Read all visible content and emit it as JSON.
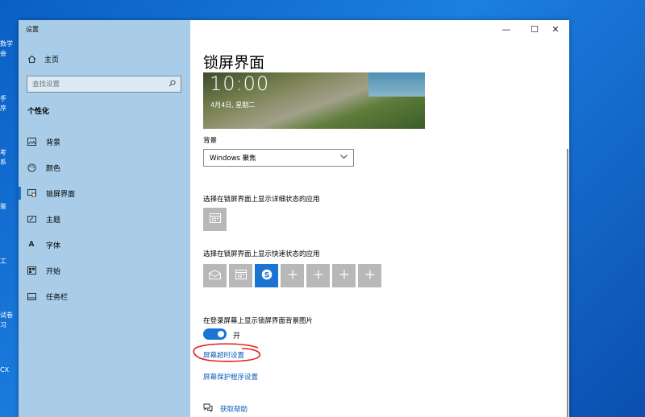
{
  "desktop": {
    "labels": [
      "数学",
      "会",
      "手",
      "序",
      "考",
      "系",
      "鉴",
      "工",
      "试卷",
      "习",
      "CX"
    ]
  },
  "window": {
    "title": "设置",
    "controls": {
      "minimize": "—",
      "maximize": "☐",
      "close": "✕"
    }
  },
  "sidebar": {
    "home_label": "主页",
    "search_placeholder": "查找设置",
    "section_title": "个性化",
    "items": [
      {
        "label": "背景",
        "icon": "image-icon"
      },
      {
        "label": "颜色",
        "icon": "palette-icon"
      },
      {
        "label": "锁屏界面",
        "icon": "lock-screen-icon"
      },
      {
        "label": "主题",
        "icon": "theme-icon"
      },
      {
        "label": "字体",
        "icon": "font-icon"
      },
      {
        "label": "开始",
        "icon": "start-icon"
      },
      {
        "label": "任务栏",
        "icon": "taskbar-icon"
      }
    ],
    "active_index": 2
  },
  "content": {
    "page_title": "锁屏界面",
    "preview": {
      "time": "10:00",
      "date": "4月4日, 星期二"
    },
    "background_label": "背景",
    "background_value": "Windows 聚焦",
    "detailed_status_label": "选择在锁屏界面上显示详细状态的应用",
    "quick_status_label": "选择在锁屏界面上显示快速状态的应用",
    "quick_apps": [
      "mail-icon",
      "calendar-icon",
      "skype-icon",
      "plus-icon",
      "plus-icon",
      "plus-icon",
      "plus-icon"
    ],
    "signin_bg_label": "在登录屏幕上显示锁屏界面背景图片",
    "toggle_state": "开",
    "screen_timeout_link": "屏幕超时设置",
    "screensaver_link": "屏幕保护程序设置",
    "help_link": "获取帮助"
  },
  "colors": {
    "accent": "#1a74d4",
    "link": "#0b5fb8",
    "sidebar_bg": "#a9cde8",
    "annotation": "#e02020"
  }
}
